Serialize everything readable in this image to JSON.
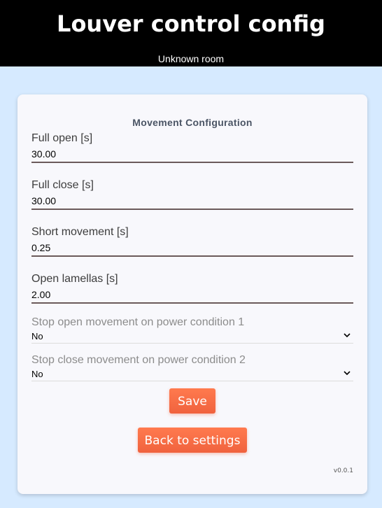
{
  "header": {
    "title": "Louver control config",
    "room": "Unknown room"
  },
  "form": {
    "section_title": "Movement Configuration",
    "fields": [
      {
        "label": "Full open [s]",
        "value": "30.00"
      },
      {
        "label": "Full close [s]",
        "value": "30.00"
      },
      {
        "label": "Short movement [s]",
        "value": "0.25"
      },
      {
        "label": "Open lamellas [s]",
        "value": "2.00"
      }
    ],
    "selects": [
      {
        "label": "Stop open movement on power condition 1",
        "value": "No",
        "icon": "chevron-down-icon"
      },
      {
        "label": "Stop close movement on power condition 2",
        "value": "No",
        "icon": "chevron-down-icon"
      }
    ]
  },
  "buttons": {
    "save_label": "Save",
    "back_label": "Back to settings"
  },
  "footer": {
    "version": "v0.0.1"
  },
  "colors": {
    "header_bg": "#000000",
    "page_bg": "#d6eaff",
    "card_bg": "#f8f8fc",
    "accent": "#f0623e"
  }
}
